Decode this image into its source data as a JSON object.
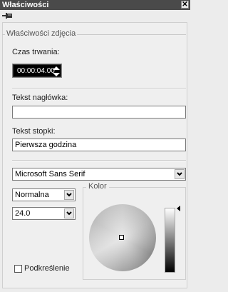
{
  "window": {
    "title": "Właściwości",
    "close_label": "✕"
  },
  "group": {
    "title": "Właściwości zdjęcia"
  },
  "duration": {
    "label": "Czas trwania:",
    "value": "00:00:04.00"
  },
  "header_text": {
    "label": "Tekst nagłówka:",
    "value": ""
  },
  "footer_text": {
    "label": "Tekst stopki:",
    "value": "Pierwsza godzina"
  },
  "font": {
    "family": "Microsoft Sans Serif",
    "style": "Normalna",
    "size": "24.0",
    "underline_label": "Podkreślenie",
    "underline_checked": false
  },
  "color": {
    "label": "Kolor",
    "selected_hex": "#ffffff"
  }
}
